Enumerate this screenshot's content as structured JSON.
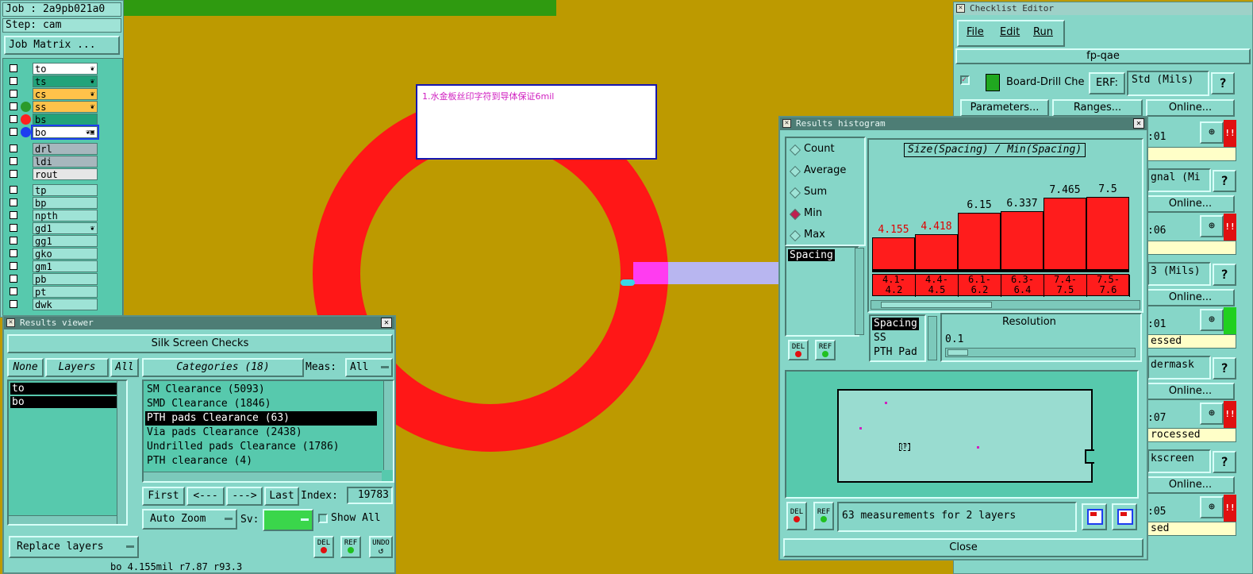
{
  "header": {
    "job_label": "Job : 2a9pb021a0",
    "step_label": "Step: cam",
    "job_matrix_button": "Job Matrix ..."
  },
  "layers_group1": [
    {
      "name": "to",
      "color": "#ffffff",
      "dot": "",
      "mark": "❦"
    },
    {
      "name": "ts",
      "color": "#21a37a",
      "dot": "",
      "mark": "❦"
    },
    {
      "name": "cs",
      "color": "#ffc24a",
      "dot": "",
      "mark": "❦"
    },
    {
      "name": "ss",
      "color": "#ffc24a",
      "dot": "#2b9a2b",
      "mark": "❦"
    },
    {
      "name": "bs",
      "color": "#21a37a",
      "dot": "#ff2020",
      "mark": ""
    },
    {
      "name": "bo",
      "color": "#ffffff",
      "dot": "#1d3df0",
      "mark": "❦▣"
    }
  ],
  "layers_group2": [
    {
      "name": "drl",
      "color": "#a7b7bd"
    },
    {
      "name": "ldi",
      "color": "#a7b7bd"
    },
    {
      "name": "rout",
      "color": "#e6e6e6"
    }
  ],
  "layers_group3": [
    {
      "name": "tp",
      "mark": ""
    },
    {
      "name": "bp",
      "mark": ""
    },
    {
      "name": "npth",
      "mark": ""
    },
    {
      "name": "gd1",
      "mark": "❦"
    },
    {
      "name": "gg1",
      "mark": ""
    },
    {
      "name": "gko",
      "mark": ""
    },
    {
      "name": "gm1",
      "mark": ""
    },
    {
      "name": "pb",
      "mark": ""
    },
    {
      "name": "pt",
      "mark": ""
    },
    {
      "name": "dwk",
      "mark": ""
    }
  ],
  "canvas": {
    "note_text": "1.水金板丝印字符到导体保证6mil",
    "ring_color": "#ff1717",
    "background": "#bd9a00"
  },
  "results_viewer": {
    "title": "Results viewer",
    "header": "Silk Screen Checks",
    "none_btn": "None",
    "layers_btn": "Layers",
    "all_btn": "All",
    "layers": [
      "to",
      "bo"
    ],
    "categories_btn": "Categories (18)",
    "meas_label": "Meas:",
    "meas_value": "All",
    "categories": [
      "SM Clearance (5093)",
      "SMD Clearance (1846)",
      "PTH pads Clearance (63)",
      "Via pads Clearance (2438)",
      "Undrilled pads Clearance (1786)",
      "PTH clearance (4)"
    ],
    "selected_index": 2,
    "first_btn": "First",
    "prev_btn": "<---",
    "next_btn": "--->",
    "last_btn": "Last",
    "index_label": "Index:",
    "index_value": "19783",
    "auto_zoom": "Auto Zoom",
    "sv_label": "Sv:",
    "show_all": "Show All",
    "replace_layers": "Replace layers",
    "del": "DEL",
    "ref": "REF",
    "undo": "UNDO",
    "status_line": "bo 4.155mil  r7.87  r93.3"
  },
  "histogram": {
    "title": "Results histogram",
    "modes": [
      {
        "label": "Count",
        "selected": false
      },
      {
        "label": "Average",
        "selected": false
      },
      {
        "label": "Sum",
        "selected": false
      },
      {
        "label": "Min",
        "selected": true
      },
      {
        "label": "Max",
        "selected": false
      }
    ],
    "spacing_list": [
      "Spacing"
    ],
    "chart_title": "Size(Spacing) / Min(Spacing)",
    "resolution_label": "Resolution",
    "resolution_value": "0.1",
    "layer_list": [
      "Spacing",
      "SS",
      "PTH Pad"
    ],
    "summary": "63 measurements for 2 layers",
    "close": "Close",
    "del": "DEL",
    "ref": "REF"
  },
  "chart_data": {
    "type": "bar",
    "title": "Size(Spacing) / Min(Spacing)",
    "categories": [
      "4.1-\n4.2",
      "4.4-\n4.5",
      "6.1-\n6.2",
      "6.3-\n6.4",
      "7.4-\n7.5",
      "7.5-\n7.6"
    ],
    "values": [
      4.155,
      4.418,
      6.15,
      6.337,
      7.465,
      7.5
    ],
    "labels": [
      "4.155",
      "4.418",
      "6.15",
      "6.337",
      "7.465",
      "7.5"
    ],
    "label_colors": [
      "#e00000",
      "#e00000",
      "#000000",
      "#000000",
      "#000000",
      "#000000"
    ],
    "ylim": [
      0,
      7.5
    ]
  },
  "checklist_editor": {
    "title": "Checklist Editor",
    "menu": [
      "File",
      "Edit",
      "Run"
    ],
    "checklist_name": "fp-qae",
    "action_label": "Board-Drill Che",
    "erf_label": "ERF:",
    "erf_value": "Std (Mils)",
    "parameters_btn": "Parameters...",
    "ranges_btn": "Ranges...",
    "online_btn": "Online...",
    "rows": [
      {
        "text": ":01",
        "yellow": "",
        "badge": "!!",
        "badge_color": "#e01010"
      },
      {
        "text": "gnal (Mi",
        "yellow": "",
        "badge": "",
        "badge_color": ""
      },
      {
        "text": ":06",
        "yellow": "",
        "badge": "!!",
        "badge_color": "#e01010"
      },
      {
        "text": "3 (Mils)",
        "yellow": "",
        "badge": "",
        "badge_color": ""
      },
      {
        "text": ":01",
        "yellow": "essed",
        "badge": "",
        "badge_color": "#20d020"
      },
      {
        "text": "dermask",
        "yellow": "",
        "badge": "",
        "badge_color": ""
      },
      {
        "text": ":07",
        "yellow": "rocessed",
        "badge": "!!",
        "badge_color": "#e01010"
      },
      {
        "text": "kscreen",
        "yellow": "",
        "badge": "",
        "badge_color": ""
      },
      {
        "text": ":05",
        "yellow": "sed",
        "badge": "!!",
        "badge_color": "#e01010"
      }
    ]
  }
}
